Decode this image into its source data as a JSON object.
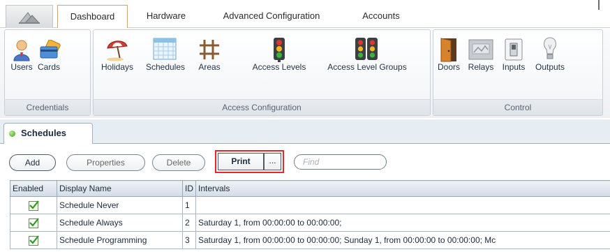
{
  "app": {
    "home_icon": "app-menu-icon",
    "tabs": [
      {
        "label": "Dashboard",
        "active": true
      },
      {
        "label": "Hardware",
        "active": false
      },
      {
        "label": "Advanced Configuration",
        "active": false
      },
      {
        "label": "Accounts",
        "active": false
      }
    ]
  },
  "ribbon": {
    "groups": [
      {
        "caption": "Credentials",
        "buttons": [
          {
            "label": "Users",
            "icon": "user-icon"
          },
          {
            "label": "Cards",
            "icon": "card-icon"
          }
        ]
      },
      {
        "caption": "Access Configuration",
        "buttons": [
          {
            "label": "Holidays",
            "icon": "holiday-umbrella-icon"
          },
          {
            "label": "Schedules",
            "icon": "calendar-icon"
          },
          {
            "label": "Areas",
            "icon": "grid-area-icon"
          },
          {
            "label": "Access Levels",
            "icon": "traffic-light-icon"
          },
          {
            "label": "Access Level Groups",
            "icon": "traffic-lights-group-icon"
          }
        ]
      },
      {
        "caption": "Control",
        "buttons": [
          {
            "label": "Doors",
            "icon": "door-icon"
          },
          {
            "label": "Relays",
            "icon": "relay-icon"
          },
          {
            "label": "Inputs",
            "icon": "switch-icon"
          },
          {
            "label": "Outputs",
            "icon": "light-bulb-icon"
          }
        ]
      }
    ]
  },
  "document_tab": {
    "label": "Schedules",
    "status": "active"
  },
  "toolbar": {
    "add": "Add",
    "properties": "Properties",
    "delete": "Delete",
    "print": "Print",
    "more": "...",
    "find_placeholder": "Find"
  },
  "grid": {
    "columns": [
      "Enabled",
      "Display Name",
      "ID",
      "Intervals"
    ],
    "rows": [
      {
        "enabled": true,
        "name": "Schedule Never",
        "id": "1",
        "intervals": ""
      },
      {
        "enabled": true,
        "name": "Schedule Always",
        "id": "2",
        "intervals": "Saturday 1, from 00:00:00 to 00:00:00;"
      },
      {
        "enabled": true,
        "name": "Schedule Programming",
        "id": "3",
        "intervals": "Saturday 1, from 00:00:00 to 00:00:00; Sunday 1, from 00:00:00 to 00:00:00; Mc"
      }
    ]
  },
  "colors": {
    "highlight": "#e12a2a",
    "active_tab_border": "#c9a675",
    "ribbon_border": "#c7cfd8"
  }
}
